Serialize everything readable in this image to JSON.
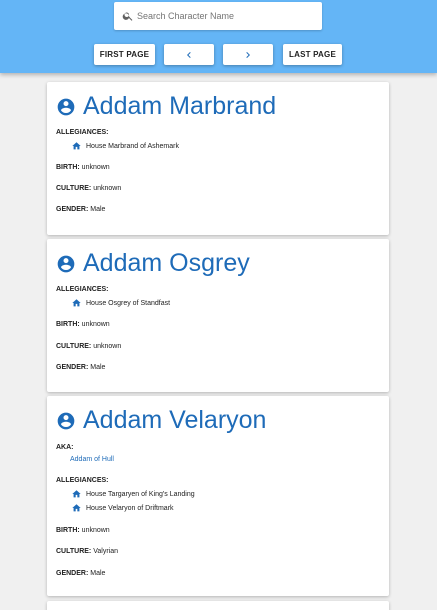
{
  "search": {
    "placeholder": "Search Character Name",
    "icon": "search-icon"
  },
  "pagination": {
    "first_label": "FIRST PAGE",
    "prev_icon": "chevron-left-icon",
    "next_icon": "chevron-right-icon",
    "last_label": "LAST PAGE"
  },
  "labels": {
    "allegiances": "ALLEGIANCES:",
    "birth": "BIRTH:",
    "culture": "CULTURE:",
    "gender": "GENDER:",
    "aka": "AKA:"
  },
  "colors": {
    "header": "#64b5f6",
    "accent": "#1e6bb8",
    "background": "#f0f0f0"
  },
  "characters": [
    {
      "name": "Addam Marbrand",
      "allegiances": [
        "House Marbrand of Ashemark"
      ],
      "birth": "unknown",
      "culture": "unknown",
      "gender": "Male"
    },
    {
      "name": "Addam Osgrey",
      "allegiances": [
        "House Osgrey of Standfast"
      ],
      "birth": "unknown",
      "culture": "unknown",
      "gender": "Male"
    },
    {
      "name": "Addam Velaryon",
      "aka": [
        "Addam of Hull"
      ],
      "allegiances": [
        "House Targaryen of King's Landing",
        "House Velaryon of Driftmark"
      ],
      "birth": "unknown",
      "culture": "Valyrian",
      "gender": "Male"
    }
  ]
}
